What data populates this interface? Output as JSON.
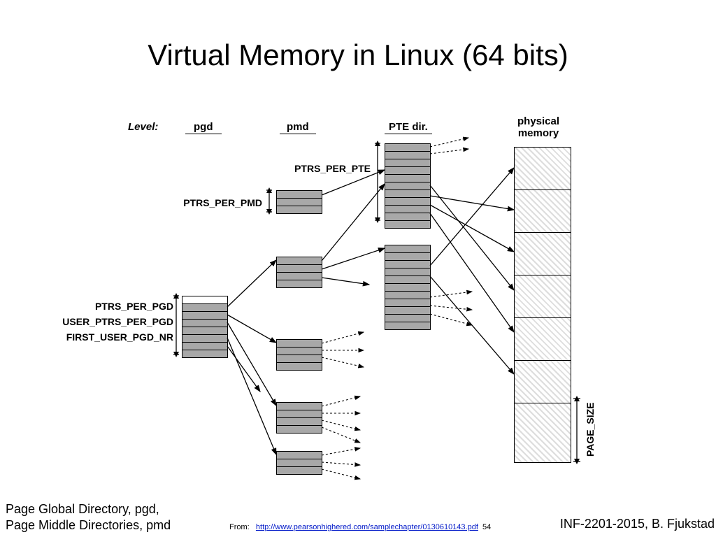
{
  "title": "Virtual Memory in Linux (64 bits)",
  "levels": {
    "label": "Level:",
    "pgd": "pgd",
    "pmd": "pmd",
    "pte": "PTE dir.",
    "phys": "physical\nmemory"
  },
  "macros": {
    "ptrs_per_pte": "PTRS_PER_PTE",
    "ptrs_per_pmd": "PTRS_PER_PMD",
    "ptrs_per_pgd": "PTRS_PER_PGD",
    "user_ptrs_per_pgd": "USER_PTRS_PER_PGD",
    "first_user_pgd_nr": "FIRST_USER_PGD_NR",
    "page_size": "PAGE_SIZE"
  },
  "footer": {
    "line1": "Page Global Directory, pgd,",
    "line2": "Page Middle Directories, pmd",
    "from": "From:",
    "url": "http://www.pearsonhighered.com/samplechapter/0130610143.pdf",
    "page": "54",
    "course": "INF-2201-2015, B. Fjukstad"
  }
}
